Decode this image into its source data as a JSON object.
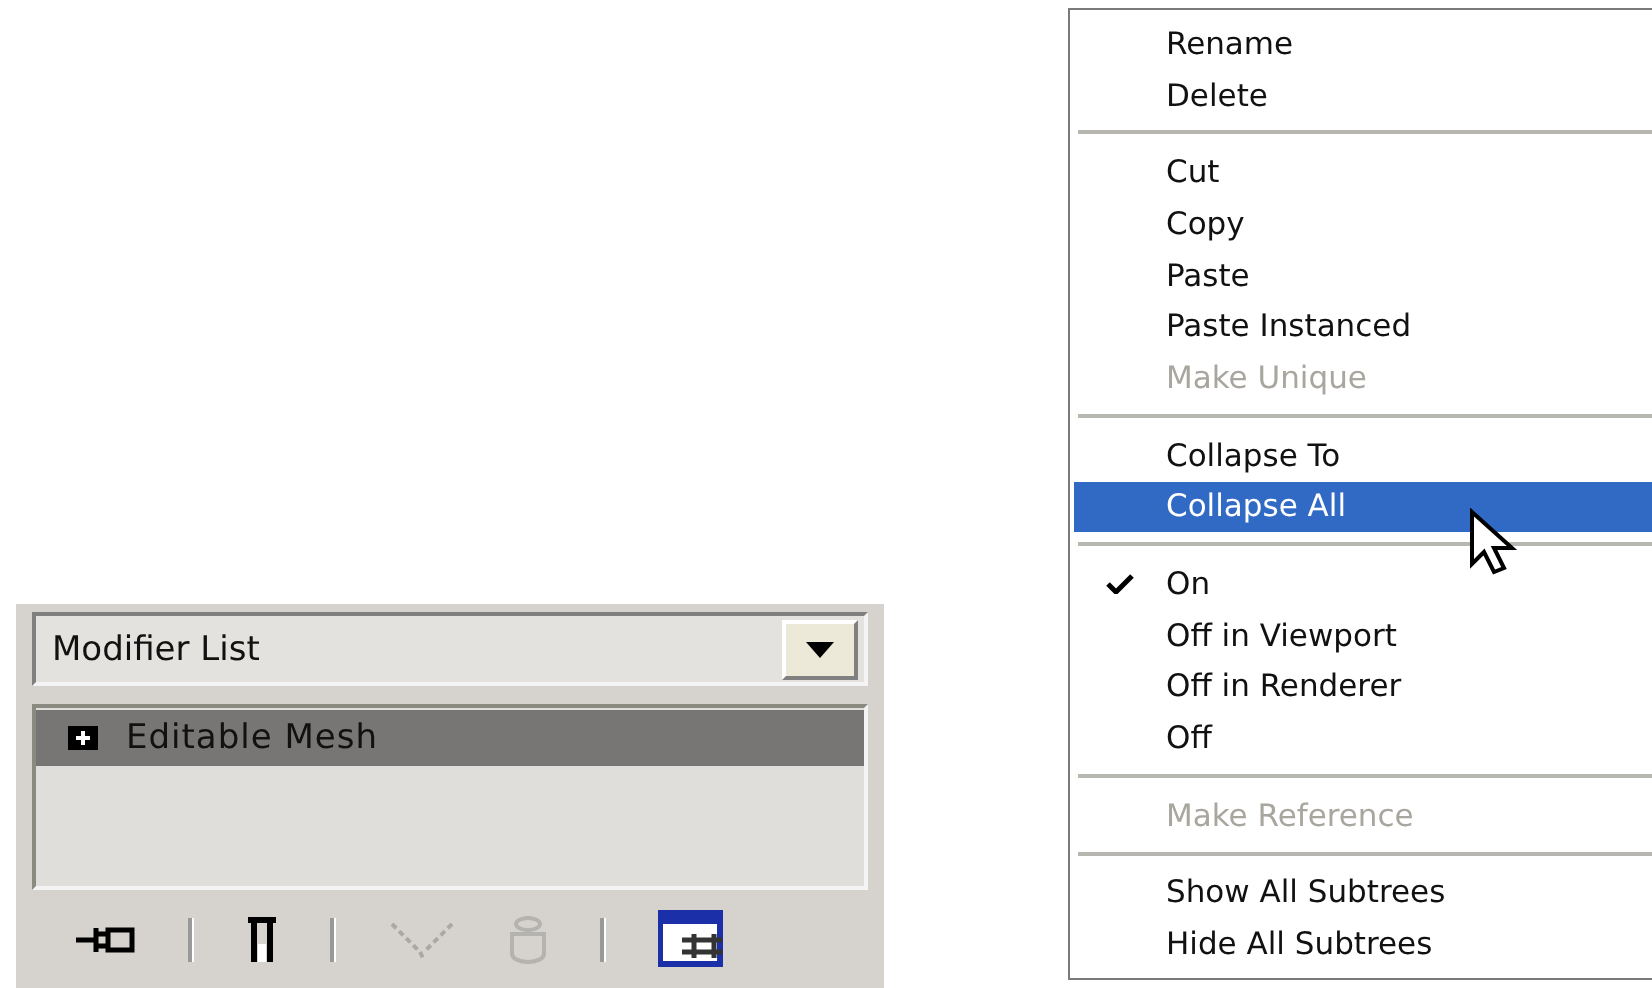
{
  "modifier_panel": {
    "dropdown": {
      "value": "Modifier List"
    },
    "stack": [
      {
        "label": "Editable Mesh",
        "expanded": false,
        "selected": true
      }
    ],
    "toolbar": [
      {
        "kind": "pin",
        "disabled": false
      },
      {
        "kind": "separator"
      },
      {
        "kind": "end-result",
        "disabled": false
      },
      {
        "kind": "separator"
      },
      {
        "kind": "make-unique",
        "disabled": true
      },
      {
        "kind": "remove",
        "disabled": true
      },
      {
        "kind": "separator"
      },
      {
        "kind": "configure",
        "disabled": false
      }
    ]
  },
  "context_menu": {
    "groups": [
      [
        {
          "label": "Rename",
          "disabled": false,
          "selected": false,
          "checked": false
        },
        {
          "label": "Delete",
          "disabled": false,
          "selected": false,
          "checked": false
        }
      ],
      [
        {
          "label": "Cut",
          "disabled": false,
          "selected": false,
          "checked": false
        },
        {
          "label": "Copy",
          "disabled": false,
          "selected": false,
          "checked": false
        },
        {
          "label": "Paste",
          "disabled": false,
          "selected": false,
          "checked": false
        },
        {
          "label": "Paste Instanced",
          "disabled": false,
          "selected": false,
          "checked": false
        },
        {
          "label": "Make Unique",
          "disabled": true,
          "selected": false,
          "checked": false
        }
      ],
      [
        {
          "label": "Collapse To",
          "disabled": false,
          "selected": false,
          "checked": false
        },
        {
          "label": "Collapse All",
          "disabled": false,
          "selected": true,
          "checked": false
        }
      ],
      [
        {
          "label": "On",
          "disabled": false,
          "selected": false,
          "checked": true
        },
        {
          "label": "Off in Viewport",
          "disabled": false,
          "selected": false,
          "checked": false
        },
        {
          "label": "Off in Renderer",
          "disabled": false,
          "selected": false,
          "checked": false
        },
        {
          "label": "Off",
          "disabled": false,
          "selected": false,
          "checked": false
        }
      ],
      [
        {
          "label": "Make Reference",
          "disabled": true,
          "selected": false,
          "checked": false
        }
      ],
      [
        {
          "label": "Show All Subtrees",
          "disabled": false,
          "selected": false,
          "checked": false
        },
        {
          "label": "Hide All Subtrees",
          "disabled": false,
          "selected": false,
          "checked": false
        }
      ]
    ]
  }
}
